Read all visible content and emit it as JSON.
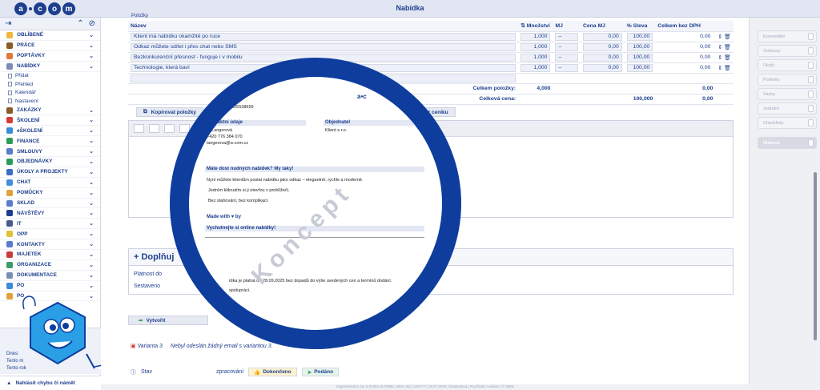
{
  "app": {
    "title": "Nabídka"
  },
  "sidebar": {
    "items": [
      {
        "label": "OBLÍBENÉ",
        "color": "#f2b63c"
      },
      {
        "label": "PRÁCE",
        "color": "#8b5a2b"
      },
      {
        "label": "POPTÁVKY",
        "color": "#e07a3c"
      },
      {
        "label": "NABÍDKY",
        "color": "#7c8cb8"
      },
      {
        "label": "Přidat",
        "sub": true
      },
      {
        "label": "Přehled",
        "sub": true
      },
      {
        "label": "Kalendář",
        "sub": true
      },
      {
        "label": "Nastavení",
        "sub": true
      },
      {
        "label": "ZAKÁZKY",
        "color": "#8b5a2b"
      },
      {
        "label": "ŠKOLENÍ",
        "color": "#d63c3c"
      },
      {
        "label": "eŠKOLENÍ",
        "color": "#3c8bd6"
      },
      {
        "label": "FINANCE",
        "color": "#2c9c5a"
      },
      {
        "label": "SMLOUVY",
        "color": "#5a7ccc"
      },
      {
        "label": "OBJEDNÁVKY",
        "color": "#2c9c5a"
      },
      {
        "label": "ÚKOLY A PROJEKTY",
        "color": "#3c6cc8"
      },
      {
        "label": "CHAT",
        "color": "#4a8ce0"
      },
      {
        "label": "POMŮCKY",
        "color": "#e0a23c"
      },
      {
        "label": "SKLAD",
        "color": "#5a7ccc"
      },
      {
        "label": "NÁVŠTĚVY",
        "color": "#1d3f8f"
      },
      {
        "label": "IT",
        "color": "#4a5a8c"
      },
      {
        "label": "OPP",
        "color": "#e0c23c"
      },
      {
        "label": "KONTAKTY",
        "color": "#5a7ccc"
      },
      {
        "label": "MAJETEK",
        "color": "#c83c3c"
      },
      {
        "label": "ORGANIZACE",
        "color": "#3c9c6c"
      },
      {
        "label": "DOKUMENTACE",
        "color": "#7c8cb8"
      },
      {
        "label": "PO",
        "color": "#3c8bd6"
      },
      {
        "label": "PO",
        "color": "#e0a23c"
      }
    ],
    "today_label": "Dnes:",
    "month_label": "Tento m",
    "year_label": "Tento rok",
    "report_bug": "Nahlásit chybu či námět"
  },
  "items_table": {
    "section_label": "Položky",
    "headers": {
      "name": "Název",
      "qty": "Množství",
      "mj": "MJ",
      "price": "Cena MJ",
      "discount": "% Sleva",
      "total": "Celkem bez DPH"
    },
    "rows": [
      {
        "name": "Klient má nabídku okamžitě po ruce",
        "qty": "1,000",
        "mj": "–",
        "price": "0,00",
        "discount": "100,00",
        "total": "0,00"
      },
      {
        "name": "Odkaz můžete sdílet i přes chat nebo SMS",
        "qty": "1,000",
        "mj": "–",
        "price": "0,00",
        "discount": "100,00",
        "total": "0,00"
      },
      {
        "name": "Bezkonkurenční přesnost - funguje i v mobilu",
        "qty": "1,000",
        "mj": "–",
        "price": "0,00",
        "discount": "100,00",
        "total": "0,00"
      },
      {
        "name": "Technologie, která baví",
        "qty": "1,000",
        "mj": "–",
        "price": "0,00",
        "discount": "100,00",
        "total": "0,00"
      }
    ],
    "sum_items_label": "Celkem položky:",
    "sum_items_qty": "4,000",
    "sum_items_total": "0,00",
    "total_price_label": "Celková cena:",
    "total_discount": "100,000",
    "total_price": "0,00"
  },
  "buttons": {
    "copy_items": "Kopírovat položky",
    "from_pricelist": "z ceníku",
    "create": "Vytvořit",
    "done": "Dokončeno",
    "submitted": "Podáno",
    "in_progress": "zpracování"
  },
  "supplement": {
    "title": "+ Doplňuj",
    "valid_until": "Platnost do",
    "compiled_by": "Sestaveno"
  },
  "variant": {
    "label": "Varianta 3",
    "email_status": "Nebyl odeslán žádný email s variantou 3."
  },
  "status": {
    "label": "Stav"
  },
  "right_panel": {
    "items": [
      "Komentáře",
      "Smlouvy",
      "Úkoly",
      "Podněty",
      "Vazby",
      "Jednání",
      "Checklisty"
    ],
    "history": "Historie"
  },
  "preview": {
    "contact_title": "Kontaktní údaje",
    "contact_name": "ta Langerová",
    "contact_phone": "+420 776 384 070",
    "contact_email": "langerova@a-com.cz",
    "orderer_title": "Objednatel",
    "orderer_name": "Klient s.r.o.",
    "promo_title": "Máte dost nudných nabídek? My taky!",
    "promo_1": "Nyní můžete klientům poslat nabídku jako odkaz – elegantně, rychle a moderně.",
    "promo_2": "Jedním kliknutím si ji otevřou v prohlížeči.",
    "promo_3": "Bez stahování, bez komplikací.",
    "made_with": "Made with ♥ by",
    "online_title": "Vychutnejte si online nabídky!",
    "address_fragment": "659, DIČ: CZ25538659",
    "footer_note": "ídka je platná do 28.09.2025 bez dopadů do výše uvedených cen a termínů dodání.",
    "footer_note2": "spolupráci.",
    "watermark": "Koncept"
  },
  "footer": {
    "text": "Vygenerováno za: 0.0135s (0.0396s; 109s; 0x) | v20177 | 16.07.2025 | Svatoslava | Používání cookies | © QMIL"
  }
}
